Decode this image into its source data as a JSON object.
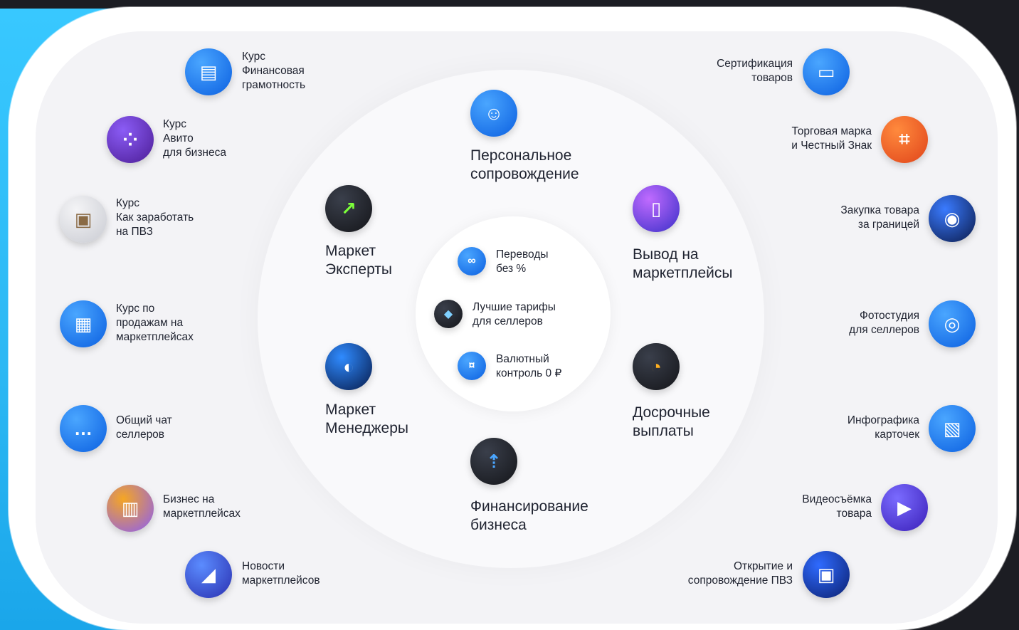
{
  "left_items": [
    {
      "icon": "document-stack-icon",
      "label": "Курс\nФинансовая\nграмотность"
    },
    {
      "icon": "avito-dots-icon",
      "label": "Курс\nАвито\nдля бизнеса"
    },
    {
      "icon": "parcel-box-icon",
      "label": "Курс\nКак заработать\nна ПВЗ"
    },
    {
      "icon": "book-icon",
      "label": "Курс по\nпродажам на\nмаркетплейсах"
    },
    {
      "icon": "chat-bubble-icon",
      "label": "Общий чат\nселлеров"
    },
    {
      "icon": "shopping-bags-icon",
      "label": "Бизнес на\nмаркетплейсах"
    },
    {
      "icon": "megaphone-icon",
      "label": "Новости\nмаркетплейсов"
    }
  ],
  "right_items": [
    {
      "icon": "folder-icon",
      "label": "Сертификация\nтоваров"
    },
    {
      "icon": "trademark-scan-icon",
      "label": "Торговая марка\nи Честный Знак"
    },
    {
      "icon": "globe-pin-icon",
      "label": "Закупка товара\nза границей"
    },
    {
      "icon": "camera-icon",
      "label": "Фотостудия\nдля селлеров"
    },
    {
      "icon": "infographic-card-icon",
      "label": "Инфографика\nкарточек"
    },
    {
      "icon": "video-play-icon",
      "label": "Видеосъёмка\nтовара"
    },
    {
      "icon": "box-icon",
      "label": "Открытие и\nсопровождение ПВЗ"
    }
  ],
  "ring_items": [
    {
      "icon": "person-icon",
      "label": "Персональное\nсопровождение"
    },
    {
      "icon": "growth-arrow-icon",
      "label": "Маркет\nЭксперты"
    },
    {
      "icon": "shopping-phone-icon",
      "label": "Вывод на\nмаркетплейсы"
    },
    {
      "icon": "manager-icon",
      "label": "Маркет\nМенеджеры"
    },
    {
      "icon": "speedometer-icon",
      "label": "Досрочные\nвыплаты"
    },
    {
      "icon": "coin-arrow-icon",
      "label": "Финансирование\nбизнеса"
    }
  ],
  "center_items": [
    {
      "icon": "infinity-icon",
      "label": "Переводы\nбез %"
    },
    {
      "icon": "tariff-icon",
      "label": "Лучшие тарифы\nдля селлеров"
    },
    {
      "icon": "currency-icon",
      "label": "Валютный\nконтроль 0 ₽"
    }
  ]
}
